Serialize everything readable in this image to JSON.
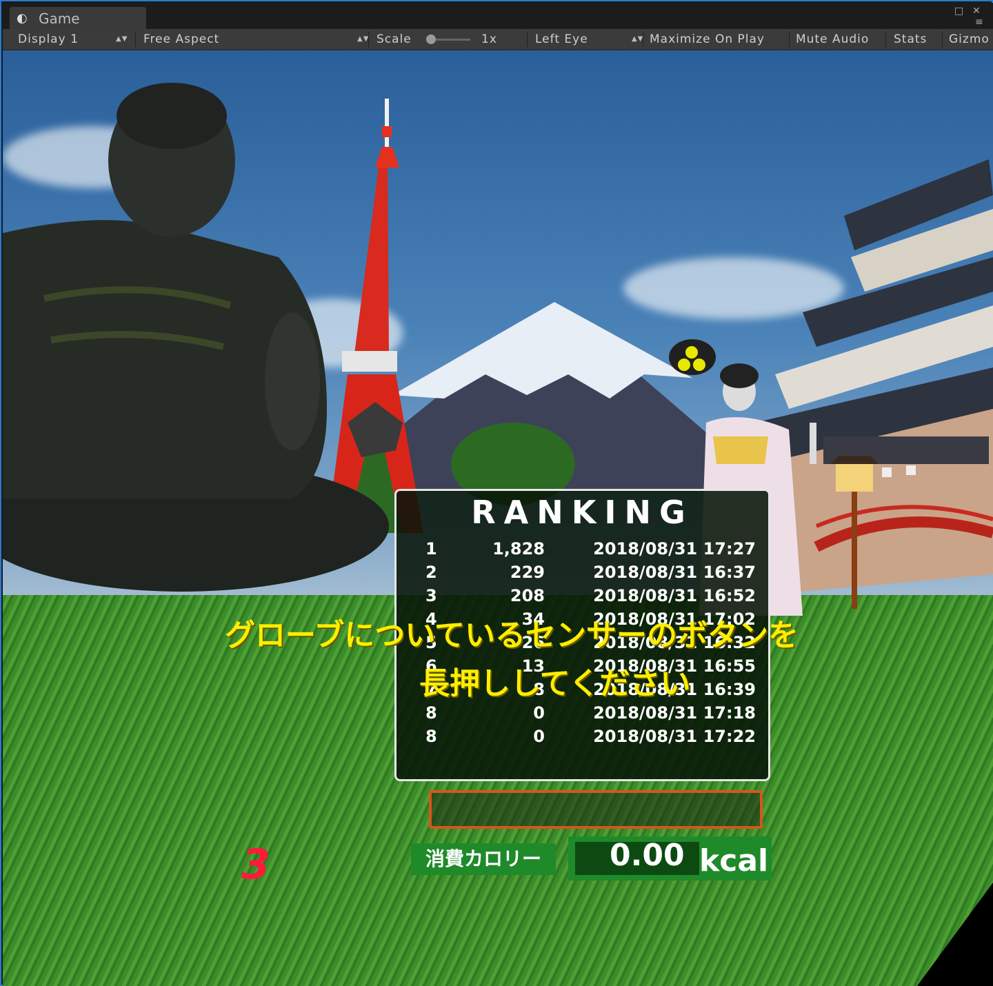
{
  "window": {
    "tab_label": "Game",
    "tab_icon": "unity-logo-icon"
  },
  "toolbar": {
    "display": "Display 1",
    "aspect": "Free Aspect",
    "scale_label": "Scale",
    "scale_value": "1x",
    "eye": "Left Eye",
    "maximize": "Maximize On Play",
    "mute": "Mute Audio",
    "stats": "Stats",
    "gizmos": "Gizmo"
  },
  "ranking": {
    "title": "RANKING",
    "rows": [
      {
        "rank": "1",
        "score": "1,828",
        "date": "2018/08/31 17:27"
      },
      {
        "rank": "2",
        "score": "229",
        "date": "2018/08/31 16:37"
      },
      {
        "rank": "3",
        "score": "208",
        "date": "2018/08/31 16:52"
      },
      {
        "rank": "4",
        "score": "34",
        "date": "2018/08/31 17:02"
      },
      {
        "rank": "5",
        "score": "26",
        "date": "2018/08/31 16:32"
      },
      {
        "rank": "6",
        "score": "13",
        "date": "2018/08/31 16:55"
      },
      {
        "rank": "7",
        "score": "8",
        "date": "2018/08/31 16:39"
      },
      {
        "rank": "8",
        "score": "0",
        "date": "2018/08/31 17:18"
      },
      {
        "rank": "8",
        "score": "0",
        "date": "2018/08/31 17:22"
      }
    ]
  },
  "prompt": {
    "line1": "グローブについているセンサーのボタンを",
    "line2": "長押ししてください"
  },
  "countdown": "3",
  "calories": {
    "label": "消費カロリー",
    "value": "0.00",
    "unit": "kcal"
  },
  "colors": {
    "prompt": "#ffee00",
    "countdown": "#ff1a3a",
    "calorie_panel": "#1f8a2a",
    "gauge_border": "#d9541c"
  }
}
